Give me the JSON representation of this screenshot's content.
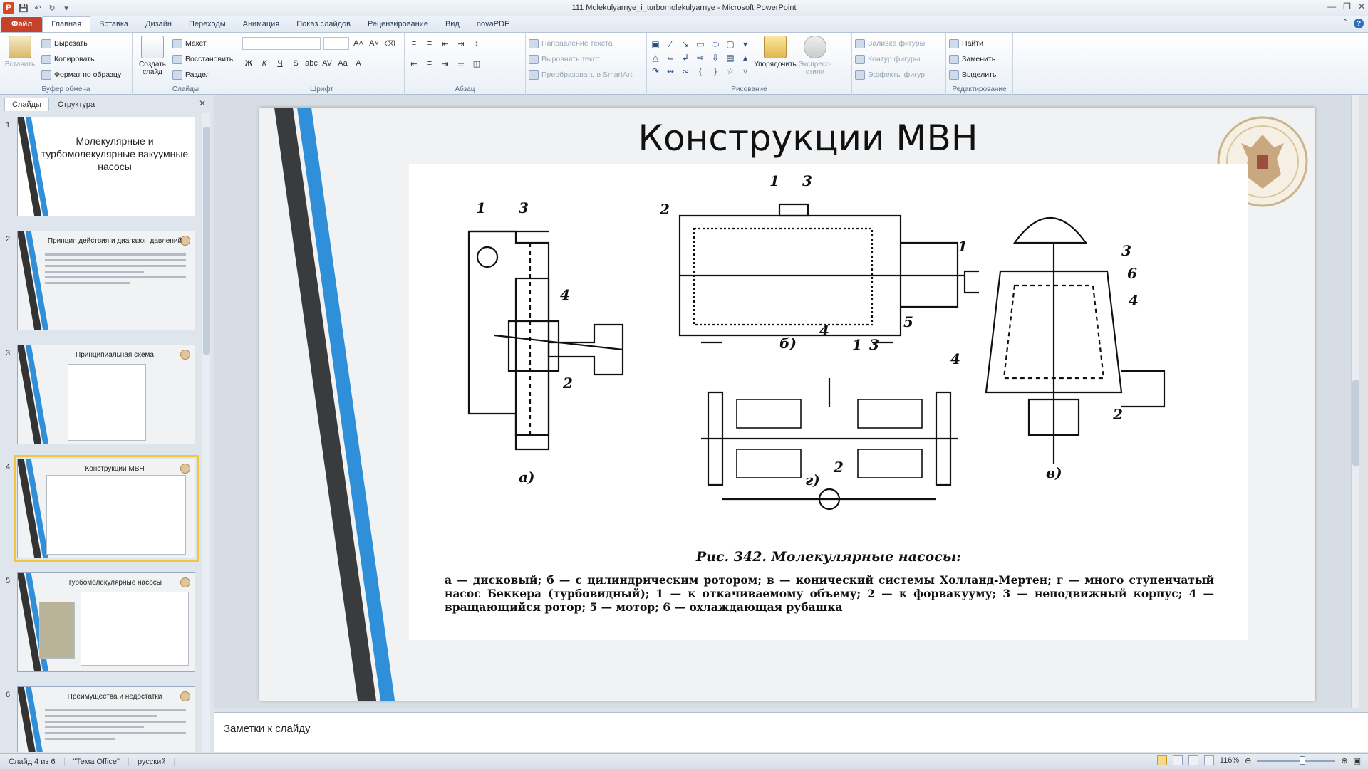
{
  "window": {
    "title": "111 Molekulyarnye_i_turbomolekulyarnye - Microsoft PowerPoint",
    "app_icon": "P"
  },
  "tabs": [
    "Файл",
    "Главная",
    "Вставка",
    "Дизайн",
    "Переходы",
    "Анимация",
    "Показ слайдов",
    "Рецензирование",
    "Вид",
    "novaPDF"
  ],
  "ribbon": {
    "clipboard": {
      "paste": "Вставить",
      "cut": "Вырезать",
      "copy": "Копировать",
      "format_painter": "Формат по образцу",
      "label": "Буфер обмена"
    },
    "slides": {
      "new_slide": "Создать слайд",
      "layout": "Макет",
      "reset": "Восстановить",
      "section": "Раздел",
      "label": "Слайды"
    },
    "font": {
      "label": "Шрифт"
    },
    "paragraph": {
      "text_direction": "Направление текста",
      "align_text": "Выровнять текст",
      "smartart": "Преобразовать в SmartArt",
      "label": "Абзац"
    },
    "drawing": {
      "arrange": "Упорядочить",
      "quick_styles": "Экспресс-стили",
      "shape_fill": "Заливка фигуры",
      "shape_outline": "Контур фигуры",
      "shape_effects": "Эффекты фигур",
      "label": "Рисование"
    },
    "editing": {
      "find": "Найти",
      "replace": "Заменить",
      "select": "Выделить",
      "label": "Редактирование"
    }
  },
  "left_pane": {
    "tabs": [
      "Слайды",
      "Структура"
    ],
    "thumbnails": [
      {
        "num": "1",
        "title": "Молекулярные и турбомолекулярные вакуумные насосы"
      },
      {
        "num": "2",
        "title": "Принцип действия и диапазон давлений"
      },
      {
        "num": "3",
        "title": "Принципиальная схема"
      },
      {
        "num": "4",
        "title": "Конструкции МВН"
      },
      {
        "num": "5",
        "title": "Турбомолекулярные насосы"
      },
      {
        "num": "6",
        "title": "Преимущества и недостатки"
      }
    ]
  },
  "slide": {
    "title": "Конструкции МВН",
    "figure_labels": {
      "a": "а)",
      "b": "б)",
      "v": "в)",
      "g": "г)",
      "n1": "1",
      "n2": "2",
      "n3": "3",
      "n4": "4",
      "n5": "5",
      "n6": "6"
    },
    "caption_title": "Рис. 342. Молекулярные насосы:",
    "caption_body": "а — дисковый; б — с цилиндрическим ротором; в — конический системы Холланд-Мертен; г — много ступенчатый насос Беккера (турбовидный); 1 — к откачиваемому объему; 2 — к форвакууму; 3 — неподвижный корпус; 4 — вращающийся ротор; 5 — мотор; 6 — охлаждающая рубашка"
  },
  "notes": {
    "placeholder": "Заметки к слайду"
  },
  "statusbar": {
    "slide_of": "Слайд 4 из 6",
    "theme": "\"Тема Office\"",
    "language": "русский",
    "zoom": "116%"
  },
  "colors": {
    "accent_blue": "#2f8fd8",
    "file_tab": "#c7402a",
    "selection": "#f3c442"
  }
}
